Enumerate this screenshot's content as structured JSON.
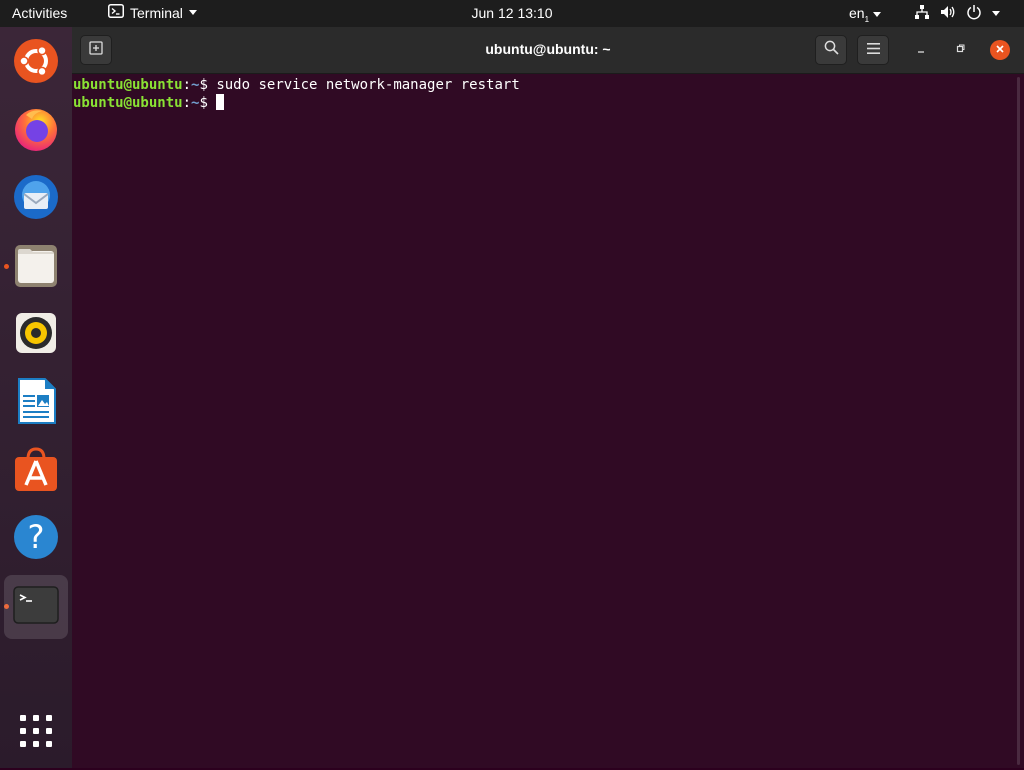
{
  "topbar": {
    "activities": "Activities",
    "app_name": "Terminal",
    "clock": "Jun 12  13:10",
    "language": "en",
    "language_sub": "1"
  },
  "dock": {
    "items": [
      {
        "name": "Ubuntu",
        "icon": "ubuntu-logo-icon"
      },
      {
        "name": "Firefox",
        "icon": "firefox-icon"
      },
      {
        "name": "Thunderbird",
        "icon": "thunderbird-icon"
      },
      {
        "name": "Files",
        "icon": "files-icon",
        "running": true
      },
      {
        "name": "Rhythmbox",
        "icon": "rhythmbox-icon"
      },
      {
        "name": "LibreOffice Writer",
        "icon": "writer-icon"
      },
      {
        "name": "Ubuntu Software",
        "icon": "software-center-icon"
      },
      {
        "name": "Help",
        "icon": "help-icon"
      },
      {
        "name": "Terminal",
        "icon": "terminal-icon",
        "running": true,
        "active": true
      }
    ],
    "show_apps": "show-applications-icon",
    "accent": "#e95420"
  },
  "window": {
    "title": "ubuntu@ubuntu: ~",
    "background": "#300a24"
  },
  "terminal": {
    "lines": [
      {
        "user": "ubuntu@ubuntu",
        "sep": ":",
        "path": "~",
        "symbol": "$",
        "command": " sudo service network-manager restart"
      },
      {
        "user": "ubuntu@ubuntu",
        "sep": ":",
        "path": "~",
        "symbol": "$",
        "command": " "
      }
    ]
  }
}
